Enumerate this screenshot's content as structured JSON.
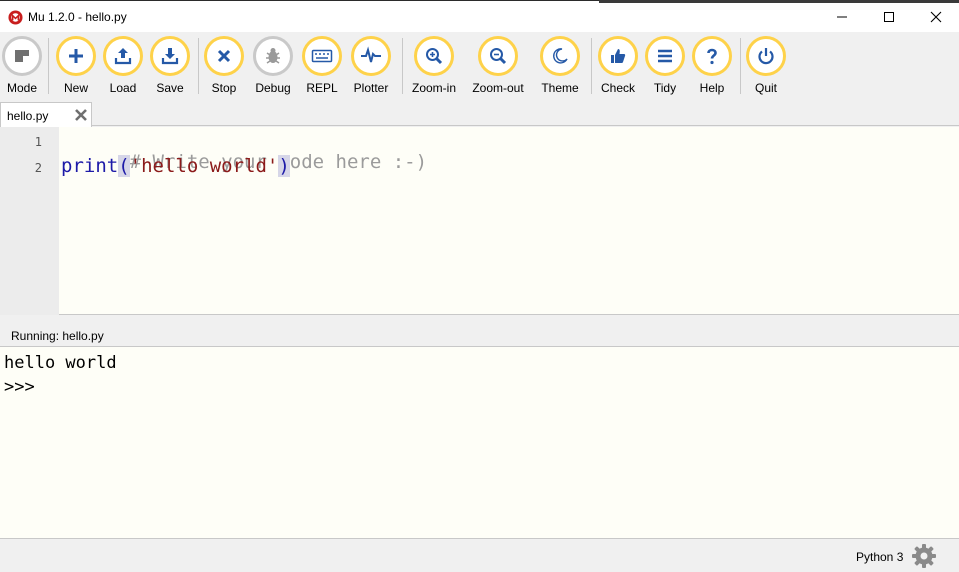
{
  "window": {
    "title": "Mu 1.2.0 - hello.py"
  },
  "toolbar": {
    "buttons": [
      {
        "label": "Mode",
        "icon": "mode-icon"
      },
      {
        "label": "New",
        "icon": "plus-icon"
      },
      {
        "label": "Load",
        "icon": "upload-icon"
      },
      {
        "label": "Save",
        "icon": "download-icon"
      },
      {
        "label": "Stop",
        "icon": "x-icon"
      },
      {
        "label": "Debug",
        "icon": "bug-icon"
      },
      {
        "label": "REPL",
        "icon": "keyboard-icon"
      },
      {
        "label": "Plotter",
        "icon": "pulse-icon"
      },
      {
        "label": "Zoom-in",
        "icon": "zoom-in-icon"
      },
      {
        "label": "Zoom-out",
        "icon": "zoom-out-icon"
      },
      {
        "label": "Theme",
        "icon": "moon-icon"
      },
      {
        "label": "Check",
        "icon": "thumbs-up-icon"
      },
      {
        "label": "Tidy",
        "icon": "lines-icon"
      },
      {
        "label": "Help",
        "icon": "question-icon"
      },
      {
        "label": "Quit",
        "icon": "power-icon"
      }
    ],
    "accent_color": "#fed24a"
  },
  "tabs": [
    {
      "label": "hello.py"
    }
  ],
  "editor": {
    "line_numbers": [
      "1",
      "2"
    ],
    "line1_comment": "# Write your code here :-)",
    "line2_func": "print",
    "line2_open": "(",
    "line2_string": "'hello world'",
    "line2_close": ")"
  },
  "repl": {
    "title": "Running: hello.py",
    "output_line": "hello world",
    "prompt": ">>>"
  },
  "status": {
    "mode": "Python 3"
  }
}
